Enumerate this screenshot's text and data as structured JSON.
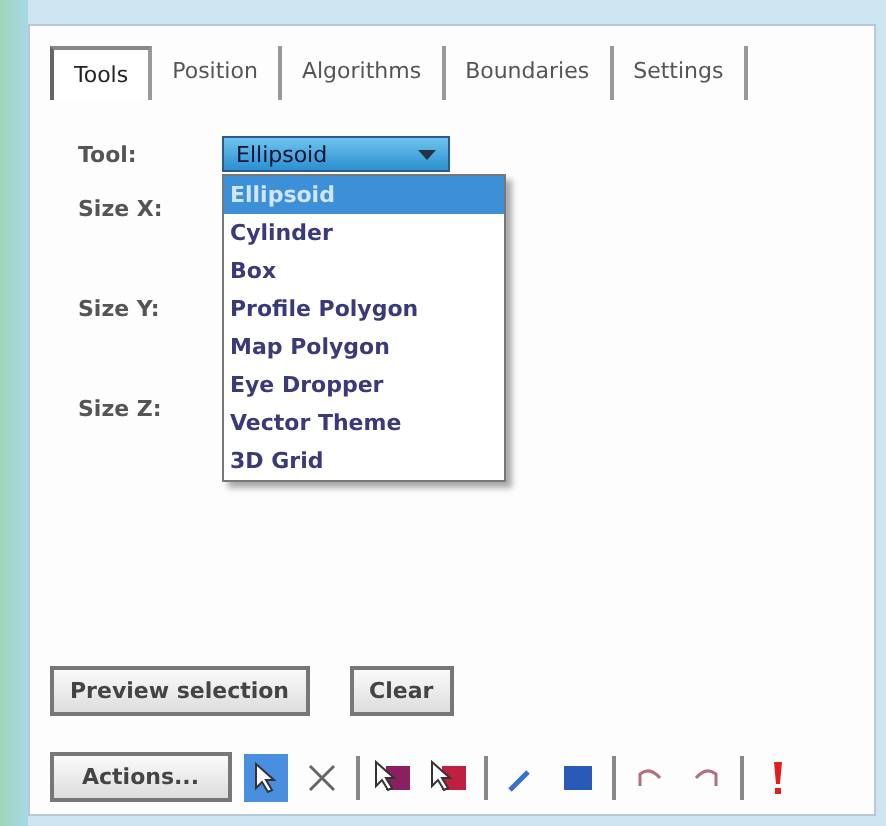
{
  "tabs": [
    {
      "label": "Tools",
      "selected": true
    },
    {
      "label": "Position",
      "selected": false
    },
    {
      "label": "Algorithms",
      "selected": false
    },
    {
      "label": "Boundaries",
      "selected": false
    },
    {
      "label": "Settings",
      "selected": false
    }
  ],
  "tool": {
    "label": "Tool:",
    "value": "Ellipsoid",
    "expanded": true,
    "options": [
      {
        "label": "Ellipsoid",
        "selected": true
      },
      {
        "label": "Cylinder",
        "selected": false
      },
      {
        "label": "Box",
        "selected": false
      },
      {
        "label": "Profile Polygon",
        "selected": false
      },
      {
        "label": "Map Polygon",
        "selected": false
      },
      {
        "label": "Eye Dropper",
        "selected": false
      },
      {
        "label": "Vector Theme",
        "selected": false
      },
      {
        "label": "3D Grid",
        "selected": false
      }
    ]
  },
  "size_labels": [
    "Size X:",
    "Size Y:",
    "Size Z:"
  ],
  "buttons": [
    "Preview selection",
    "Clear"
  ],
  "actions_button": "Actions...",
  "toolbar": [
    {
      "kind": "pointer",
      "selected": true
    },
    {
      "kind": "cross",
      "selected": false
    },
    {
      "kind": "sep"
    },
    {
      "kind": "select-add",
      "selected": false
    },
    {
      "kind": "select-remove",
      "selected": false
    },
    {
      "kind": "sep"
    },
    {
      "kind": "dropper",
      "selected": false
    },
    {
      "kind": "square",
      "selected": false
    },
    {
      "kind": "sep"
    },
    {
      "kind": "undo",
      "selected": false
    },
    {
      "kind": "redo",
      "selected": false
    },
    {
      "kind": "sep"
    },
    {
      "kind": "alert",
      "selected": false
    }
  ]
}
